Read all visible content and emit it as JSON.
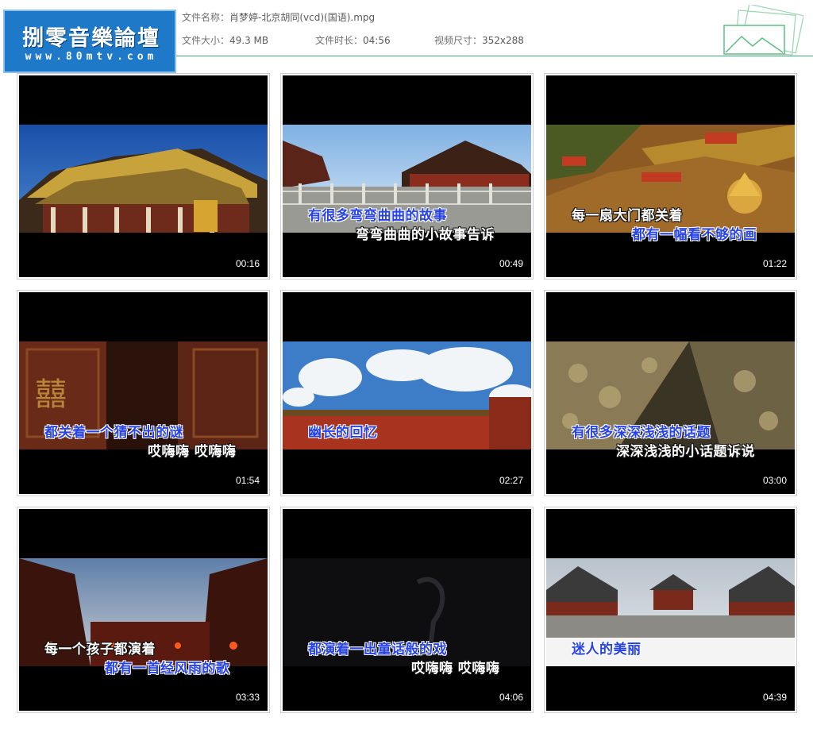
{
  "header": {
    "logo_title": "捌零音樂論壇",
    "logo_url": "www.80mtv.com",
    "file_name_label": "文件名称：",
    "file_name": "肖梦婷-北京胡同(vcd)(国语).mpg",
    "file_size_label": "文件大小：",
    "file_size": "49.3 MB",
    "duration_label": "文件时长：",
    "duration": "04:56",
    "dimensions_label": "视频尺寸：",
    "dimensions": "352x288"
  },
  "colors": {
    "accent_line": "#3aa86a",
    "logo_bg": "#1f79c9",
    "lyric_sung": "#2743e8",
    "lyric_unsung": "#ffffff"
  },
  "thumbnails": [
    {
      "timestamp": "00:16",
      "line1": "",
      "line2": ""
    },
    {
      "timestamp": "00:49",
      "line1": "有很多弯弯曲曲的故事",
      "line2": "弯弯曲曲的小故事告诉"
    },
    {
      "timestamp": "01:22",
      "line1": "每一扇大门都关着",
      "line2": "都有一幅看不够的画"
    },
    {
      "timestamp": "01:54",
      "line1": "都关着一个猜不出的谜",
      "line2": "哎嗨嗨 哎嗨嗨"
    },
    {
      "timestamp": "02:27",
      "line1": "幽长的回忆",
      "line2": ""
    },
    {
      "timestamp": "03:00",
      "line1": "有很多深深浅浅的话题",
      "line2": "深深浅浅的小话题诉说"
    },
    {
      "timestamp": "03:33",
      "line1": "每一个孩子都演着",
      "line2": "都有一首经风雨的歌"
    },
    {
      "timestamp": "04:06",
      "line1": "都演着一出童话般的戏",
      "line2": "哎嗨嗨 哎嗨嗨"
    },
    {
      "timestamp": "04:39",
      "line1": "迷人的美丽",
      "line2": ""
    }
  ]
}
